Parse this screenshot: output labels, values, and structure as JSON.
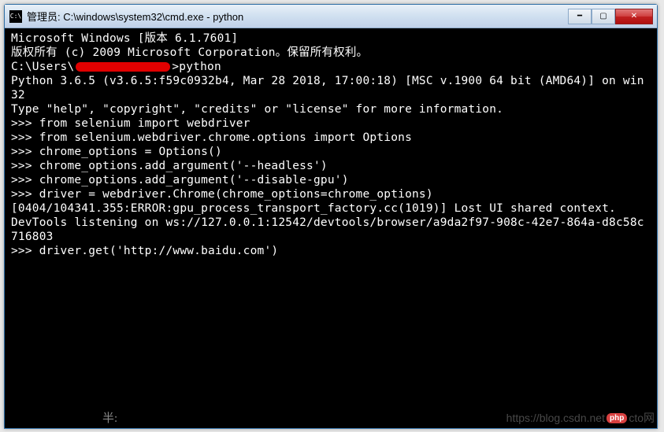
{
  "titlebar": {
    "icon_text": "C:\\",
    "title": "管理员: C:\\windows\\system32\\cmd.exe - python"
  },
  "window_buttons": {
    "minimize": "━",
    "maximize": "▢",
    "close": "✕"
  },
  "terminal": {
    "line1": "Microsoft Windows [版本 6.1.7601]",
    "line2": "版权所有 (c) 2009 Microsoft Corporation。保留所有权利。",
    "blank1": "",
    "prompt_prefix": "C:\\Users\\",
    "prompt_suffix": ">python",
    "py1": "Python 3.6.5 (v3.6.5:f59c0932b4, Mar 28 2018, 17:00:18) [MSC v.1900 64 bit (AMD64)] on win32",
    "py2": "Type \"help\", \"copyright\", \"credits\" or \"license\" for more information.",
    "r1": ">>> from selenium import webdriver",
    "r2": ">>> from selenium.webdriver.chrome.options import Options",
    "r3": ">>> chrome_options = Options()",
    "r4": ">>> chrome_options.add_argument('--headless')",
    "r5": ">>> chrome_options.add_argument('--disable-gpu')",
    "r6": ">>> driver = webdriver.Chrome(chrome_options=chrome_options)",
    "err": "[0404/104341.355:ERROR:gpu_process_transport_factory.cc(1019)] Lost UI shared context.",
    "blank2": "",
    "dev": "DevTools listening on ws://127.0.0.1:12542/devtools/browser/a9da2f97-908c-42e7-864a-d8c58c716803",
    "r7": ">>> driver.get('http://www.baidu.com')"
  },
  "footer": {
    "ban_label": "半:",
    "watermark": "https://blog.csdn.net",
    "php_badge": "php",
    "cto": "cto网"
  }
}
